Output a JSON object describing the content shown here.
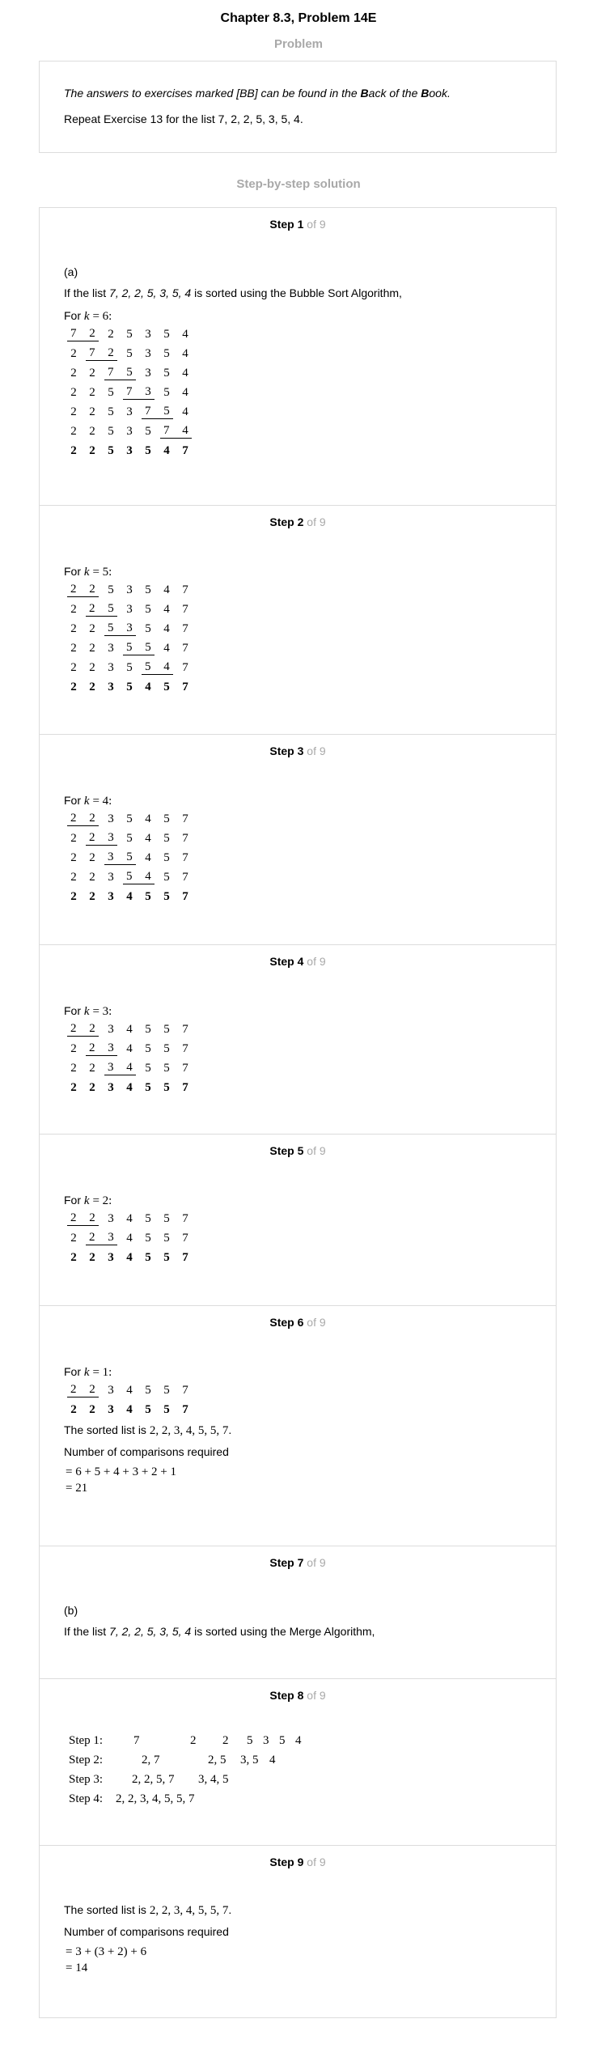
{
  "header": {
    "title": "Chapter 8.3, Problem 14E",
    "problem_heading": "Problem",
    "solution_heading": "Step-by-step solution"
  },
  "problem": {
    "line1": "The answers to exercises marked [BB] can be found in the Back of the Book.",
    "line2": "Repeat Exercise 13 for the list 7, 2, 2, 5, 3, 5, 4."
  },
  "steps_of": "of 9",
  "step_word": "Step",
  "steps": {
    "s1": {
      "num": "1",
      "part": "(a)",
      "intro_pre": "If the list ",
      "intro_list": "7, 2, 2, 5, 3, 5, 4",
      "intro_post": " is sorted using the Bubble Sort Algorithm,",
      "for": "For",
      "k": "k",
      "eq": "= 6",
      "rows": [
        [
          "7",
          "2",
          "2",
          "5",
          "3",
          "5",
          "4"
        ],
        [
          "2",
          "7",
          "2",
          "5",
          "3",
          "5",
          "4"
        ],
        [
          "2",
          "2",
          "7",
          "5",
          "3",
          "5",
          "4"
        ],
        [
          "2",
          "2",
          "5",
          "7",
          "3",
          "5",
          "4"
        ],
        [
          "2",
          "2",
          "5",
          "3",
          "7",
          "5",
          "4"
        ],
        [
          "2",
          "2",
          "5",
          "3",
          "5",
          "7",
          "4"
        ],
        [
          "2",
          "2",
          "5",
          "3",
          "5",
          "4",
          "7"
        ]
      ]
    },
    "s2": {
      "num": "2",
      "for": "For",
      "k": "k",
      "eq": "= 5",
      "rows": [
        [
          "2",
          "2",
          "5",
          "3",
          "5",
          "4",
          "7"
        ],
        [
          "2",
          "2",
          "5",
          "3",
          "5",
          "4",
          "7"
        ],
        [
          "2",
          "2",
          "5",
          "3",
          "5",
          "4",
          "7"
        ],
        [
          "2",
          "2",
          "3",
          "5",
          "5",
          "4",
          "7"
        ],
        [
          "2",
          "2",
          "3",
          "5",
          "5",
          "4",
          "7"
        ],
        [
          "2",
          "2",
          "3",
          "5",
          "4",
          "5",
          "7"
        ]
      ]
    },
    "s3": {
      "num": "3",
      "for": "For",
      "k": "k",
      "eq": "= 4",
      "rows": [
        [
          "2",
          "2",
          "3",
          "5",
          "4",
          "5",
          "7"
        ],
        [
          "2",
          "2",
          "3",
          "5",
          "4",
          "5",
          "7"
        ],
        [
          "2",
          "2",
          "3",
          "5",
          "4",
          "5",
          "7"
        ],
        [
          "2",
          "2",
          "3",
          "5",
          "4",
          "5",
          "7"
        ],
        [
          "2",
          "2",
          "3",
          "4",
          "5",
          "5",
          "7"
        ]
      ]
    },
    "s4": {
      "num": "4",
      "for": "For",
      "k": "k",
      "eq": "= 3",
      "rows": [
        [
          "2",
          "2",
          "3",
          "4",
          "5",
          "5",
          "7"
        ],
        [
          "2",
          "2",
          "3",
          "4",
          "5",
          "5",
          "7"
        ],
        [
          "2",
          "2",
          "3",
          "4",
          "5",
          "5",
          "7"
        ],
        [
          "2",
          "2",
          "3",
          "4",
          "5",
          "5",
          "7"
        ]
      ]
    },
    "s5": {
      "num": "5",
      "for": "For ",
      "k": "k",
      "eq": "= 2",
      "rows": [
        [
          "2",
          "2",
          "3",
          "4",
          "5",
          "5",
          "7"
        ],
        [
          "2",
          "2",
          "3",
          "4",
          "5",
          "5",
          "7"
        ],
        [
          "2",
          "2",
          "3",
          "4",
          "5",
          "5",
          "7"
        ]
      ]
    },
    "s6": {
      "num": "6",
      "for": "For",
      "k": "k",
      "eq": "= 1",
      "rows": [
        [
          "2",
          "2",
          "3",
          "4",
          "5",
          "5",
          "7"
        ],
        [
          "2",
          "2",
          "3",
          "4",
          "5",
          "5",
          "7"
        ]
      ],
      "sorted_pre": "The sorted list is ",
      "sorted_list": "2, 2, 3, 4, 5, 5, 7",
      "comparisons": "Number of comparisons required",
      "calc1": "= 6 + 5 + 4 + 3 + 2 + 1",
      "calc2": "= 21"
    },
    "s7": {
      "num": "7",
      "part": "(b)",
      "intro_pre": "If the list ",
      "intro_list": "7, 2, 2, 5, 3, 5, 4",
      "intro_post": " is sorted using the Merge Algorithm,"
    },
    "s8": {
      "num": "8",
      "rows": [
        {
          "label": "Step 1:",
          "cols": [
            "7",
            "2",
            "2",
            "5",
            "3",
            "5",
            "4"
          ]
        },
        {
          "label": "Step 2:",
          "cols": [
            "2, 7",
            "2, 5",
            "3, 5",
            "4"
          ]
        },
        {
          "label": "Step 3:",
          "cols": [
            "2, 2, 5, 7",
            "3, 4, 5"
          ]
        },
        {
          "label": "Step 4:",
          "cols": [
            "2, 2, 3, 4, 5, 5, 7"
          ]
        }
      ]
    },
    "s9": {
      "num": "9",
      "sorted_pre": "The sorted list is ",
      "sorted_list": "2, 2, 3, 4, 5, 5, 7",
      "comparisons": "Number of comparisons required",
      "calc1": "= 3 + (3 + 2) + 6",
      "calc2": "= 14"
    }
  }
}
